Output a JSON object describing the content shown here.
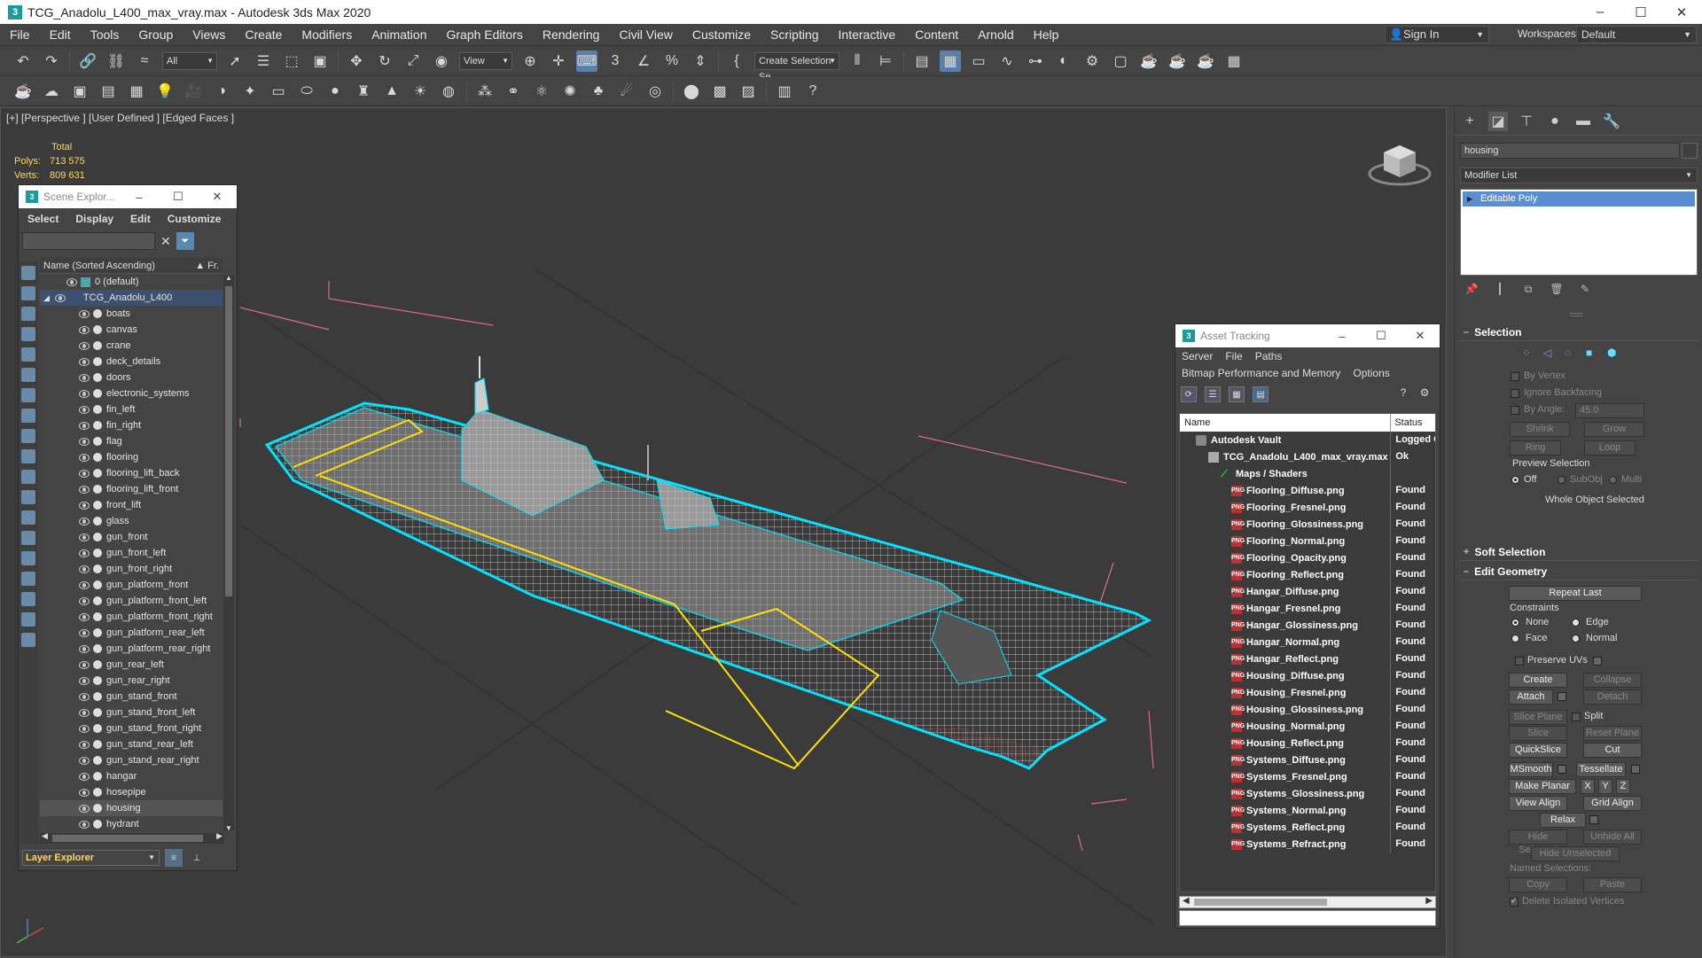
{
  "window": {
    "title": "TCG_Anadolu_L400_max_vray.max - Autodesk 3ds Max 2020",
    "app_icon": "3"
  },
  "menu": [
    "File",
    "Edit",
    "Tools",
    "Group",
    "Views",
    "Create",
    "Modifiers",
    "Animation",
    "Graph Editors",
    "Rendering",
    "Civil View",
    "Customize",
    "Scripting",
    "Interactive",
    "Content",
    "Arnold",
    "Help"
  ],
  "signin": "Sign In",
  "workspace": {
    "label": "Workspaces:",
    "value": "Default"
  },
  "toolbar": {
    "filter": "All",
    "refcoord": "View",
    "selset": "Create Selection Se"
  },
  "viewport": {
    "label": "[+] [Perspective ] [User Defined ] [Edged Faces ]",
    "stats": {
      "total": "Total",
      "polys_label": "Polys:",
      "polys": "713 575",
      "verts_label": "Verts:",
      "verts": "809 631"
    }
  },
  "scene_explorer": {
    "title": "Scene Explor...",
    "menu": [
      "Select",
      "Display",
      "Edit",
      "Customize"
    ],
    "header": "Name (Sorted Ascending)",
    "header_right": "▲ Fr.",
    "layer_default": "0 (default)",
    "root": "TCG_Anadolu_L400",
    "items": [
      "boats",
      "canvas",
      "crane",
      "deck_details",
      "doors",
      "electronic_systems",
      "fin_left",
      "fin_right",
      "flag",
      "flooring",
      "flooring_lift_back",
      "flooring_lift_front",
      "front_lift",
      "glass",
      "gun_front",
      "gun_front_left",
      "gun_front_right",
      "gun_platform_front",
      "gun_platform_front_left",
      "gun_platform_front_right",
      "gun_platform_rear_left",
      "gun_platform_rear_right",
      "gun_rear_left",
      "gun_rear_right",
      "gun_stand_front",
      "gun_stand_front_left",
      "gun_stand_front_right",
      "gun_stand_rear_left",
      "gun_stand_rear_right",
      "hangar",
      "hosepipe",
      "housing",
      "hydrant"
    ],
    "bottom_label": "Layer Explorer"
  },
  "asset_tracking": {
    "title": "Asset Tracking",
    "menu1": [
      "Server",
      "File",
      "Paths"
    ],
    "menu2": [
      "Bitmap Performance and Memory",
      "Options"
    ],
    "col_name": "Name",
    "col_status": "Status",
    "vault": {
      "name": "Autodesk Vault",
      "status": "Logged Out"
    },
    "file": {
      "name": "TCG_Anadolu_L400_max_vray.max",
      "status": "Ok"
    },
    "maps_label": "Maps / Shaders",
    "maps": [
      {
        "name": "Flooring_Diffuse.png",
        "status": "Found"
      },
      {
        "name": "Flooring_Fresnel.png",
        "status": "Found"
      },
      {
        "name": "Flooring_Glossiness.png",
        "status": "Found"
      },
      {
        "name": "Flooring_Normal.png",
        "status": "Found"
      },
      {
        "name": "Flooring_Opacity.png",
        "status": "Found"
      },
      {
        "name": "Flooring_Reflect.png",
        "status": "Found"
      },
      {
        "name": "Hangar_Diffuse.png",
        "status": "Found"
      },
      {
        "name": "Hangar_Fresnel.png",
        "status": "Found"
      },
      {
        "name": "Hangar_Glossiness.png",
        "status": "Found"
      },
      {
        "name": "Hangar_Normal.png",
        "status": "Found"
      },
      {
        "name": "Hangar_Reflect.png",
        "status": "Found"
      },
      {
        "name": "Housing_Diffuse.png",
        "status": "Found"
      },
      {
        "name": "Housing_Fresnel.png",
        "status": "Found"
      },
      {
        "name": "Housing_Glossiness.png",
        "status": "Found"
      },
      {
        "name": "Housing_Normal.png",
        "status": "Found"
      },
      {
        "name": "Housing_Reflect.png",
        "status": "Found"
      },
      {
        "name": "Systems_Diffuse.png",
        "status": "Found"
      },
      {
        "name": "Systems_Fresnel.png",
        "status": "Found"
      },
      {
        "name": "Systems_Glossiness.png",
        "status": "Found"
      },
      {
        "name": "Systems_Normal.png",
        "status": "Found"
      },
      {
        "name": "Systems_Reflect.png",
        "status": "Found"
      },
      {
        "name": "Systems_Refract.png",
        "status": "Found"
      }
    ]
  },
  "command_panel": {
    "object_name": "housing",
    "modifier_list": "Modifier List",
    "stack_item": "Editable Poly",
    "selection": {
      "title": "Selection",
      "by_vertex": "By Vertex",
      "ignore_backfacing": "Ignore Backfacing",
      "by_angle": "By Angle:",
      "angle_value": "45.0",
      "shrink": "Shrink",
      "grow": "Grow",
      "ring": "Ring",
      "loop": "Loop",
      "preview_selection": "Preview Selection",
      "off": "Off",
      "subobj": "SubObj",
      "multi": "Multi",
      "whole_object": "Whole Object Selected"
    },
    "soft_selection": "Soft Selection",
    "edit_geometry": {
      "title": "Edit Geometry",
      "repeat_last": "Repeat Last",
      "constraints": "Constraints",
      "none": "None",
      "edge": "Edge",
      "face": "Face",
      "normal": "Normal",
      "preserve_uvs": "Preserve UVs",
      "create": "Create",
      "collapse": "Collapse",
      "attach": "Attach",
      "detach": "Detach",
      "slice_plane": "Slice Plane",
      "split": "Split",
      "slice": "Slice",
      "reset_plane": "Reset Plane",
      "quickslice": "QuickSlice",
      "cut": "Cut",
      "msmooth": "MSmooth",
      "tessellate": "Tessellate",
      "make_planar": "Make Planar",
      "x": "X",
      "y": "Y",
      "z": "Z",
      "view_align": "View Align",
      "grid_align": "Grid Align",
      "relax": "Relax",
      "hide_selected": "Hide Selected",
      "unhide_all": "Unhide All",
      "hide_unselected": "Hide Unselected",
      "named_selections": "Named Selections:",
      "copy": "Copy",
      "paste": "Paste",
      "delete_isolated": "Delete Isolated Vertices"
    }
  },
  "colors": {
    "selection_blue": "#5b8ed1",
    "wire_cyan": "#00e5ff",
    "stats_yellow": "#ffd76a"
  }
}
